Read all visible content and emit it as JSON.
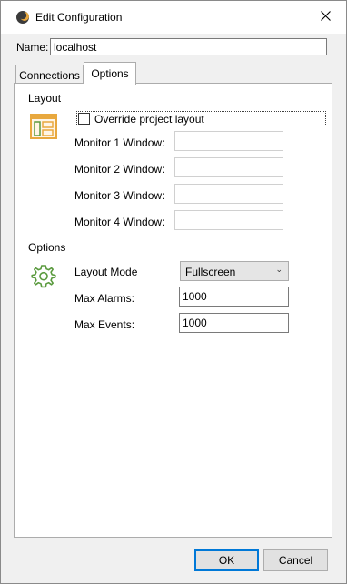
{
  "window": {
    "title": "Edit Configuration",
    "icons": {
      "app": "moon-app-icon",
      "close": "close-icon"
    }
  },
  "name_field": {
    "label": "Name:",
    "value": "localhost"
  },
  "tabs": [
    {
      "label": "Connections",
      "selected": false
    },
    {
      "label": "Options",
      "selected": true
    }
  ],
  "layout_group": {
    "header": "Layout",
    "icon": "layout-icon",
    "override_checkbox": {
      "label": "Override project layout",
      "checked": false
    },
    "monitors": [
      {
        "label": "Monitor 1 Window:",
        "value": ""
      },
      {
        "label": "Monitor 2 Window:",
        "value": ""
      },
      {
        "label": "Monitor 3 Window:",
        "value": ""
      },
      {
        "label": "Monitor 4 Window:",
        "value": ""
      }
    ]
  },
  "options_group": {
    "header": "Options",
    "icon": "gear-icon",
    "layout_mode": {
      "label": "Layout Mode",
      "value": "Fullscreen"
    },
    "max_alarms": {
      "label": "Max Alarms:",
      "value": "1000"
    },
    "max_events": {
      "label": "Max Events:",
      "value": "1000"
    }
  },
  "buttons": {
    "ok": "OK",
    "cancel": "Cancel"
  },
  "colors": {
    "accent": "#0078d7",
    "icon_orange": "#e8a83e",
    "icon_green": "#5a9a3e"
  }
}
